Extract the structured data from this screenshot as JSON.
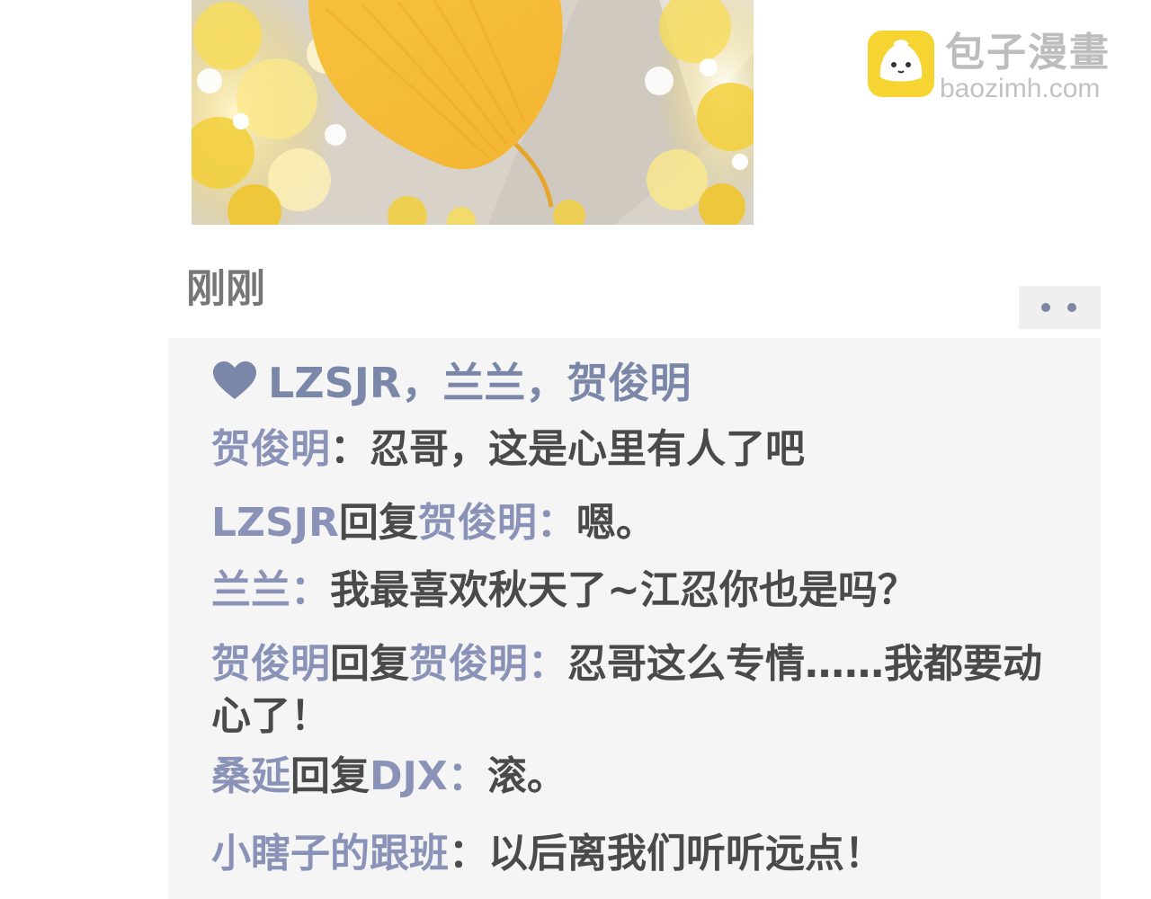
{
  "watermark": {
    "name_cn": "包子漫畫",
    "url": "baozimh.com",
    "logo_icon": "bun-mascot-icon"
  },
  "post": {
    "image_icon": "ginkgo-leaf-illustration",
    "timestamp": "刚刚",
    "more_icon": "more-dots-icon"
  },
  "likes": {
    "icon": "heart-icon",
    "names": "LZSJR，兰兰，贺俊明"
  },
  "comments": [
    {
      "author": "贺俊明",
      "sep": "：",
      "text": "忍哥，这是心里有人了吧"
    },
    {
      "author": "LZSJR",
      "reply_word": "回复",
      "target": "贺俊明",
      "sep": "：",
      "text": "嗯。"
    },
    {
      "author": "兰兰",
      "sep": "：",
      "text": "我最喜欢秋天了~江忍你也是吗？"
    },
    {
      "author": "贺俊明",
      "reply_word": "回复",
      "target": "贺俊明",
      "sep": "：",
      "text": "忍哥这么专情……我都要动心了！"
    },
    {
      "author": "桑延",
      "reply_word": "回复",
      "target": "DJX",
      "sep": "：",
      "text": "滚。"
    },
    {
      "author": "小瞎子的跟班",
      "sep": "：",
      "text": "以后离我们听听远点！"
    }
  ],
  "colors": {
    "name": "#8a93b7",
    "text": "#4a4a4a",
    "panel_bg": "#f5f5f5",
    "heart": "#7b87a8",
    "timestamp": "#767676"
  }
}
